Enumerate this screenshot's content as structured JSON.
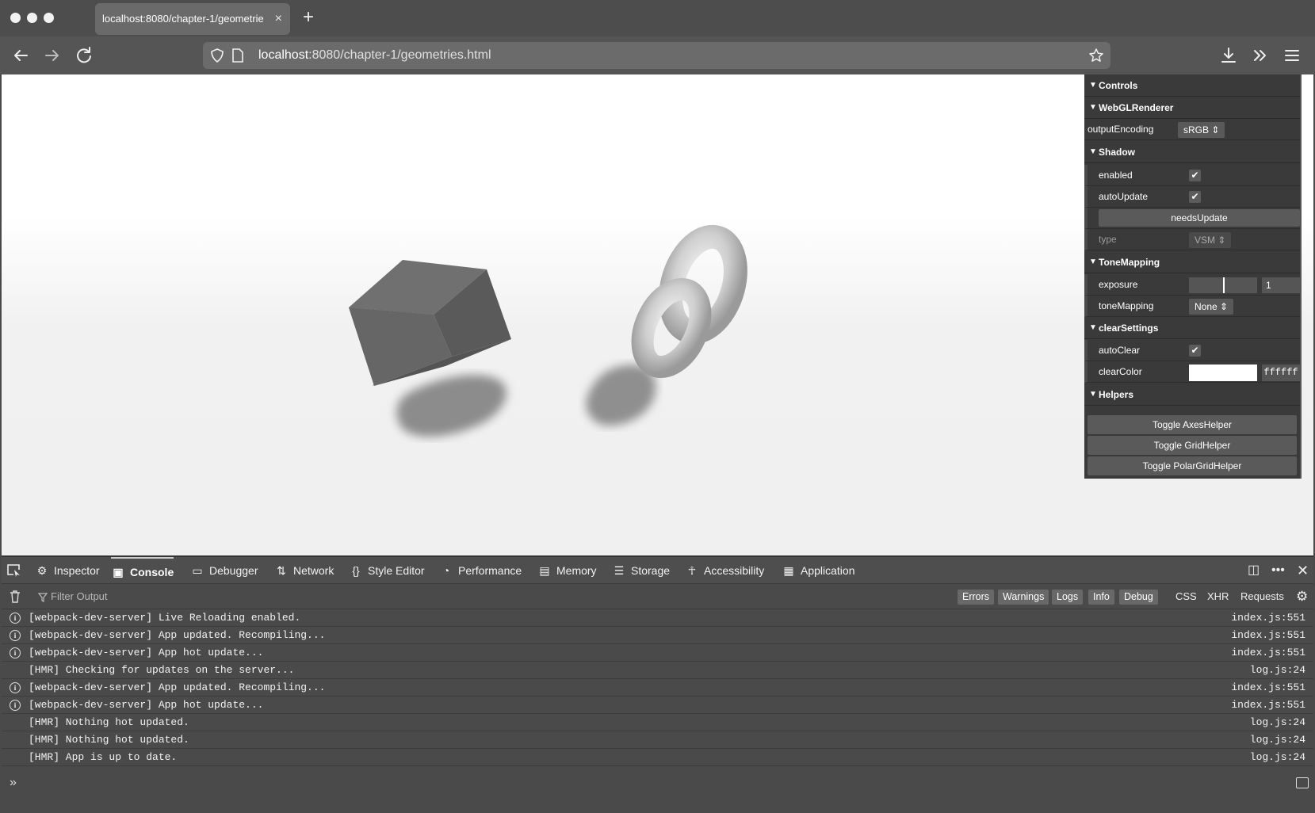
{
  "browser": {
    "tab_title": "localhost:8080/chapter-1/geometrie",
    "tab_close": "×",
    "new_tab": "+",
    "url_host": "localhost",
    "url_path": ":8080/chapter-1/geometries.html"
  },
  "gui": {
    "controls": "Controls",
    "renderer": "WebGLRenderer",
    "outputEncoding_label": "outputEncoding",
    "outputEncoding_value": "sRGB",
    "shadow": "Shadow",
    "enabled_label": "enabled",
    "autoUpdate_label": "autoUpdate",
    "needsUpdate_label": "needsUpdate",
    "type_label": "type",
    "type_value": "VSM",
    "toneMapping_folder": "ToneMapping",
    "exposure_label": "exposure",
    "exposure_value": "1",
    "toneMapping_label": "toneMapping",
    "toneMapping_value": "None",
    "clearSettings": "clearSettings",
    "autoClear_label": "autoClear",
    "clearColor_label": "clearColor",
    "clearColor_value": "ffffff",
    "helpers": "Helpers",
    "toggle_axes": "Toggle AxesHelper",
    "toggle_grid": "Toggle GridHelper",
    "toggle_polar": "Toggle PolarGridHelper"
  },
  "devtools": {
    "tabs": {
      "inspector": "Inspector",
      "console": "Console",
      "debugger": "Debugger",
      "network": "Network",
      "style_editor": "Style Editor",
      "performance": "Performance",
      "memory": "Memory",
      "storage": "Storage",
      "accessibility": "Accessibility",
      "application": "Application"
    },
    "filter_placeholder": "Filter Output",
    "filters": {
      "errors": "Errors",
      "warnings": "Warnings",
      "logs": "Logs",
      "info": "Info",
      "debug": "Debug",
      "css": "CSS",
      "xhr": "XHR",
      "requests": "Requests"
    },
    "logs": [
      {
        "msg": "[webpack-dev-server] Live Reloading enabled.",
        "src": "index.js:551",
        "info": "i"
      },
      {
        "msg": "[webpack-dev-server] App updated. Recompiling...",
        "src": "index.js:551",
        "info": "i"
      },
      {
        "msg": "[webpack-dev-server] App hot update...",
        "src": "index.js:551",
        "info": "i"
      },
      {
        "msg": "[HMR] Checking for updates on the server...",
        "src": "log.js:24",
        "info": ""
      },
      {
        "msg": "[webpack-dev-server] App updated. Recompiling...",
        "src": "index.js:551",
        "info": "i"
      },
      {
        "msg": "[webpack-dev-server] App hot update...",
        "src": "index.js:551",
        "info": "i"
      },
      {
        "msg": "[HMR] Nothing hot updated.",
        "src": "log.js:24",
        "info": ""
      },
      {
        "msg": "[HMR] Nothing hot updated.",
        "src": "log.js:24",
        "info": ""
      },
      {
        "msg": "[HMR] App is up to date.",
        "src": "log.js:24",
        "info": ""
      }
    ]
  }
}
